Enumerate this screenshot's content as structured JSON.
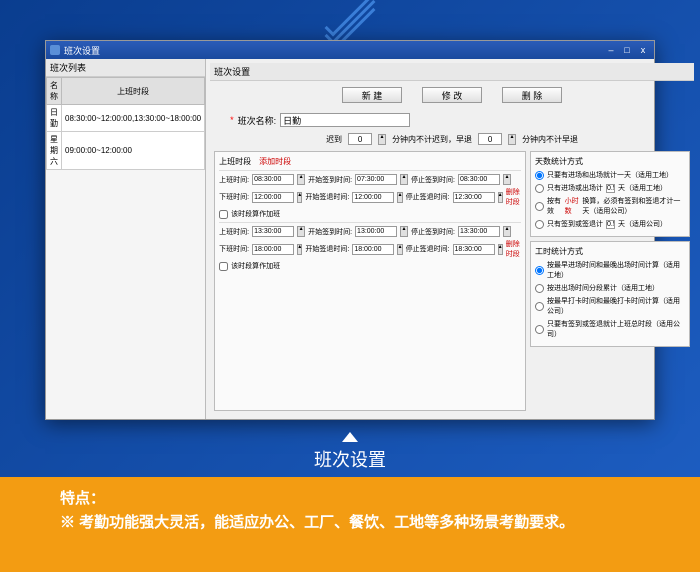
{
  "window": {
    "title": "班次设置",
    "min": "–",
    "max": "□",
    "close": "x"
  },
  "left": {
    "panel_title": "班次列表",
    "col_name": "名称",
    "col_time": "上班时段",
    "rows": [
      {
        "name": "日勤",
        "time": "08:30:00~12:00:00,13:30:00~18:00:00"
      },
      {
        "name": "星期六",
        "time": "09:00:00~12:00:00"
      }
    ]
  },
  "right": {
    "panel_title": "班次设置",
    "btn_new": "新      建",
    "btn_edit": "修      改",
    "btn_delete": "删      除",
    "name_label": "班次名称:",
    "name_value": "日勤",
    "late_label": "迟到",
    "late_value": "0",
    "late_suffix": "分钟内不计迟到，早退",
    "early_value": "0",
    "early_suffix": "分钟内不计早退"
  },
  "time_section": {
    "header_label": "上班时段",
    "add_link": "添加时段",
    "periods": [
      {
        "start_label": "上班时间:",
        "start": "08:30:00",
        "signin_label": "开始签到时间:",
        "signin": "07:30:00",
        "signin_end_label": "停止签到时间:",
        "signin_end": "08:30:00",
        "end_label": "下班时间:",
        "end": "12:00:00",
        "signout_label": "开始签退时间:",
        "signout": "12:00:00",
        "signout_end_label": "停止签退时间:",
        "signout_end": "12:30:00",
        "delete": "删除时段",
        "overtime_label": "该时段算作加班",
        "overtime_checked": false
      },
      {
        "start_label": "上班时间:",
        "start": "13:30:00",
        "signin_label": "开始签到时间:",
        "signin": "13:00:00",
        "signin_end_label": "停止签到时间:",
        "signin_end": "13:30:00",
        "end_label": "下班时间:",
        "end": "18:00:00",
        "signout_label": "开始签退时间:",
        "signout": "18:00:00",
        "signout_end_label": "停止签退时间:",
        "signout_end": "18:30:00",
        "delete": "删除时段",
        "overtime_label": "该时段算作加班",
        "overtime_checked": false
      }
    ]
  },
  "stats": {
    "title": "天数统计方式",
    "opt1": "只要有进场和出场就计一天（适用工地）",
    "opt2_a": "只有进场或出场计",
    "opt2_val": "0.5",
    "opt2_b": "天（适用工地）",
    "opt3_a": "按有效",
    "opt3_b": "小时数",
    "opt3_c": "换算，必须有签到和签退才计一天（适用公司）",
    "opt4_a": "只有签到或签退计",
    "opt4_val": "0.5",
    "opt4_b": "天（适用公司）"
  },
  "hours": {
    "title": "工时统计方式",
    "opt1": "按最早进场时间和最晚出场时间计算（适用工地）",
    "opt2": "按进出场时间分段累计（适用工地）",
    "opt3": "按最早打卡时间和最晚打卡时间计算（适用公司）",
    "opt4": "只要有签到或签退就计上班总时段（适用公司）"
  },
  "caption": "班次设置",
  "features": {
    "title": "特点：",
    "desc": "※ 考勤功能强大灵活，能适应办公、工厂、餐饮、工地等多种场景考勤要求。"
  }
}
